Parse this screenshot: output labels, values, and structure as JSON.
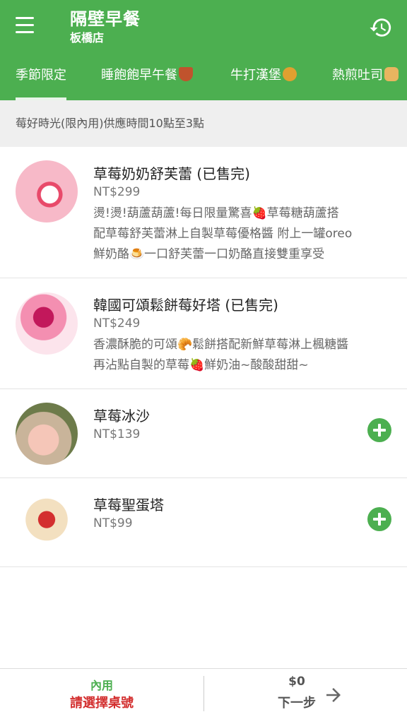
{
  "header": {
    "title": "隔壁早餐",
    "subtitle": "板橋店"
  },
  "tabs": [
    {
      "label": "季節限定",
      "active": true
    },
    {
      "label": "睡飽飽早午餐",
      "emoji": "heart"
    },
    {
      "label": "牛打漢堡",
      "emoji": "burger"
    },
    {
      "label": "熱煎吐司",
      "emoji": "bread"
    }
  ],
  "notice": "莓好時光(限內用)供應時間10點至3點",
  "items": [
    {
      "name": "草莓奶奶舒芙蕾 (已售完)",
      "price": "NT$299",
      "desc": [
        "燙!燙!葫蘆葫蘆!每日限量驚喜🍓草莓糖葫蘆搭",
        "配草莓舒芙蕾淋上自製草莓優格醬 附上一罐oreo",
        "鮮奶酪🍮一口舒芙蕾一口奶酪直接雙重享受"
      ],
      "sold_out": true
    },
    {
      "name": "韓國可頌鬆餅莓好塔 (已售完)",
      "price": "NT$249",
      "desc": [
        "香濃酥脆的可頌🥐鬆餅搭配新鮮草莓淋上楓糖醬",
        "再沾點自製的草莓🍓鮮奶油~酸酸甜甜~"
      ],
      "sold_out": true
    },
    {
      "name": "草莓冰沙",
      "price": "NT$139",
      "desc": [],
      "sold_out": false
    },
    {
      "name": "草莓聖蛋塔",
      "price": "NT$99",
      "desc": [],
      "sold_out": false
    }
  ],
  "bottom": {
    "dine_type": "內用",
    "table_prompt": "請選擇桌號",
    "total": "$0",
    "next_label": "下一步"
  },
  "colors": {
    "primary": "#4caf50",
    "warning": "#d32f2f"
  }
}
